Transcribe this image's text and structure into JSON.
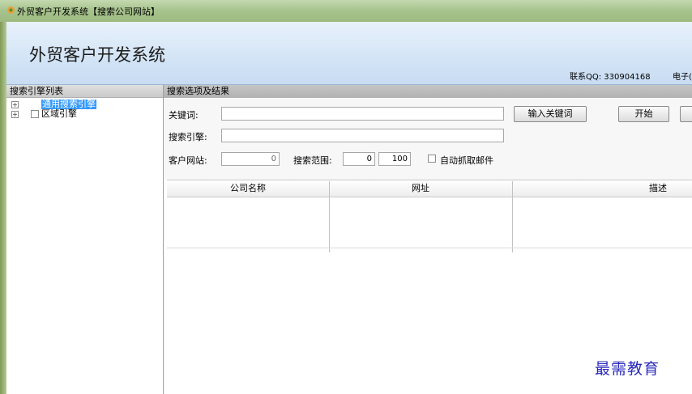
{
  "window": {
    "title": "外贸客户开发系统【搜索公司网站】",
    "icon": "app-icon"
  },
  "header": {
    "app_title": "外贸客户开发系统",
    "contact_qq": "联系QQ: 330904168",
    "contact_email": "电子("
  },
  "left_panel": {
    "title": "搜索引擎列表",
    "items": [
      {
        "label": "通用搜索引擎",
        "selected": true,
        "expander": "+"
      },
      {
        "label": "区域引擎",
        "selected": false,
        "expander": "+"
      }
    ]
  },
  "right_panel": {
    "title": "搜索选项及结果",
    "keyword_label": "关键词:",
    "keyword_value": "",
    "enter_keyword_button": "输入关键词",
    "start_button": "开始",
    "engine_label": "搜索引擎:",
    "engine_value": "",
    "client_site_label": "客户网站:",
    "client_site_value": "0",
    "range_label": "搜索范围:",
    "range_from": "0",
    "range_to": "100",
    "auto_email_label": "自动抓取邮件",
    "auto_email_checked": false
  },
  "results_table": {
    "columns": [
      "公司名称",
      "网址",
      "描述"
    ],
    "rows": []
  },
  "watermark": "最需教育",
  "colors": {
    "selection": "#3399ff",
    "header_bg": "#d3e4f6",
    "watermark": "#2b2bbd"
  }
}
